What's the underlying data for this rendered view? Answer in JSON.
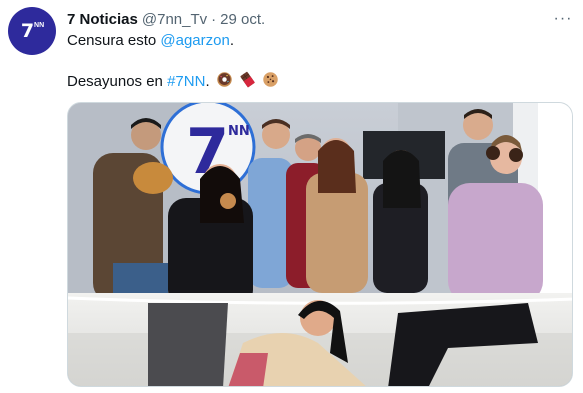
{
  "tweet": {
    "display_name": "7 Noticias",
    "handle": "@7nn_Tv",
    "separator": "·",
    "date": "29 oct.",
    "more_icon": "more-horizontal-icon",
    "avatar": {
      "logo_text": "7",
      "logo_sup": "NN",
      "bg": "#2e2a9c"
    },
    "line1": {
      "prefix": "Censura esto ",
      "mention": "@agarzon",
      "suffix": "."
    },
    "line2": {
      "prefix": "Desayunos en ",
      "hashtag": "#7NN",
      "suffix": ".",
      "emojis": [
        "donut-emoji",
        "chocolate-bar-emoji",
        "cookie-emoji"
      ]
    },
    "media": {
      "logo_text": "7",
      "logo_sup": "NN"
    }
  },
  "colors": {
    "link": "#1d9bf0",
    "muted": "#536471",
    "text": "#0f1419",
    "brand": "#2e2a9c"
  }
}
